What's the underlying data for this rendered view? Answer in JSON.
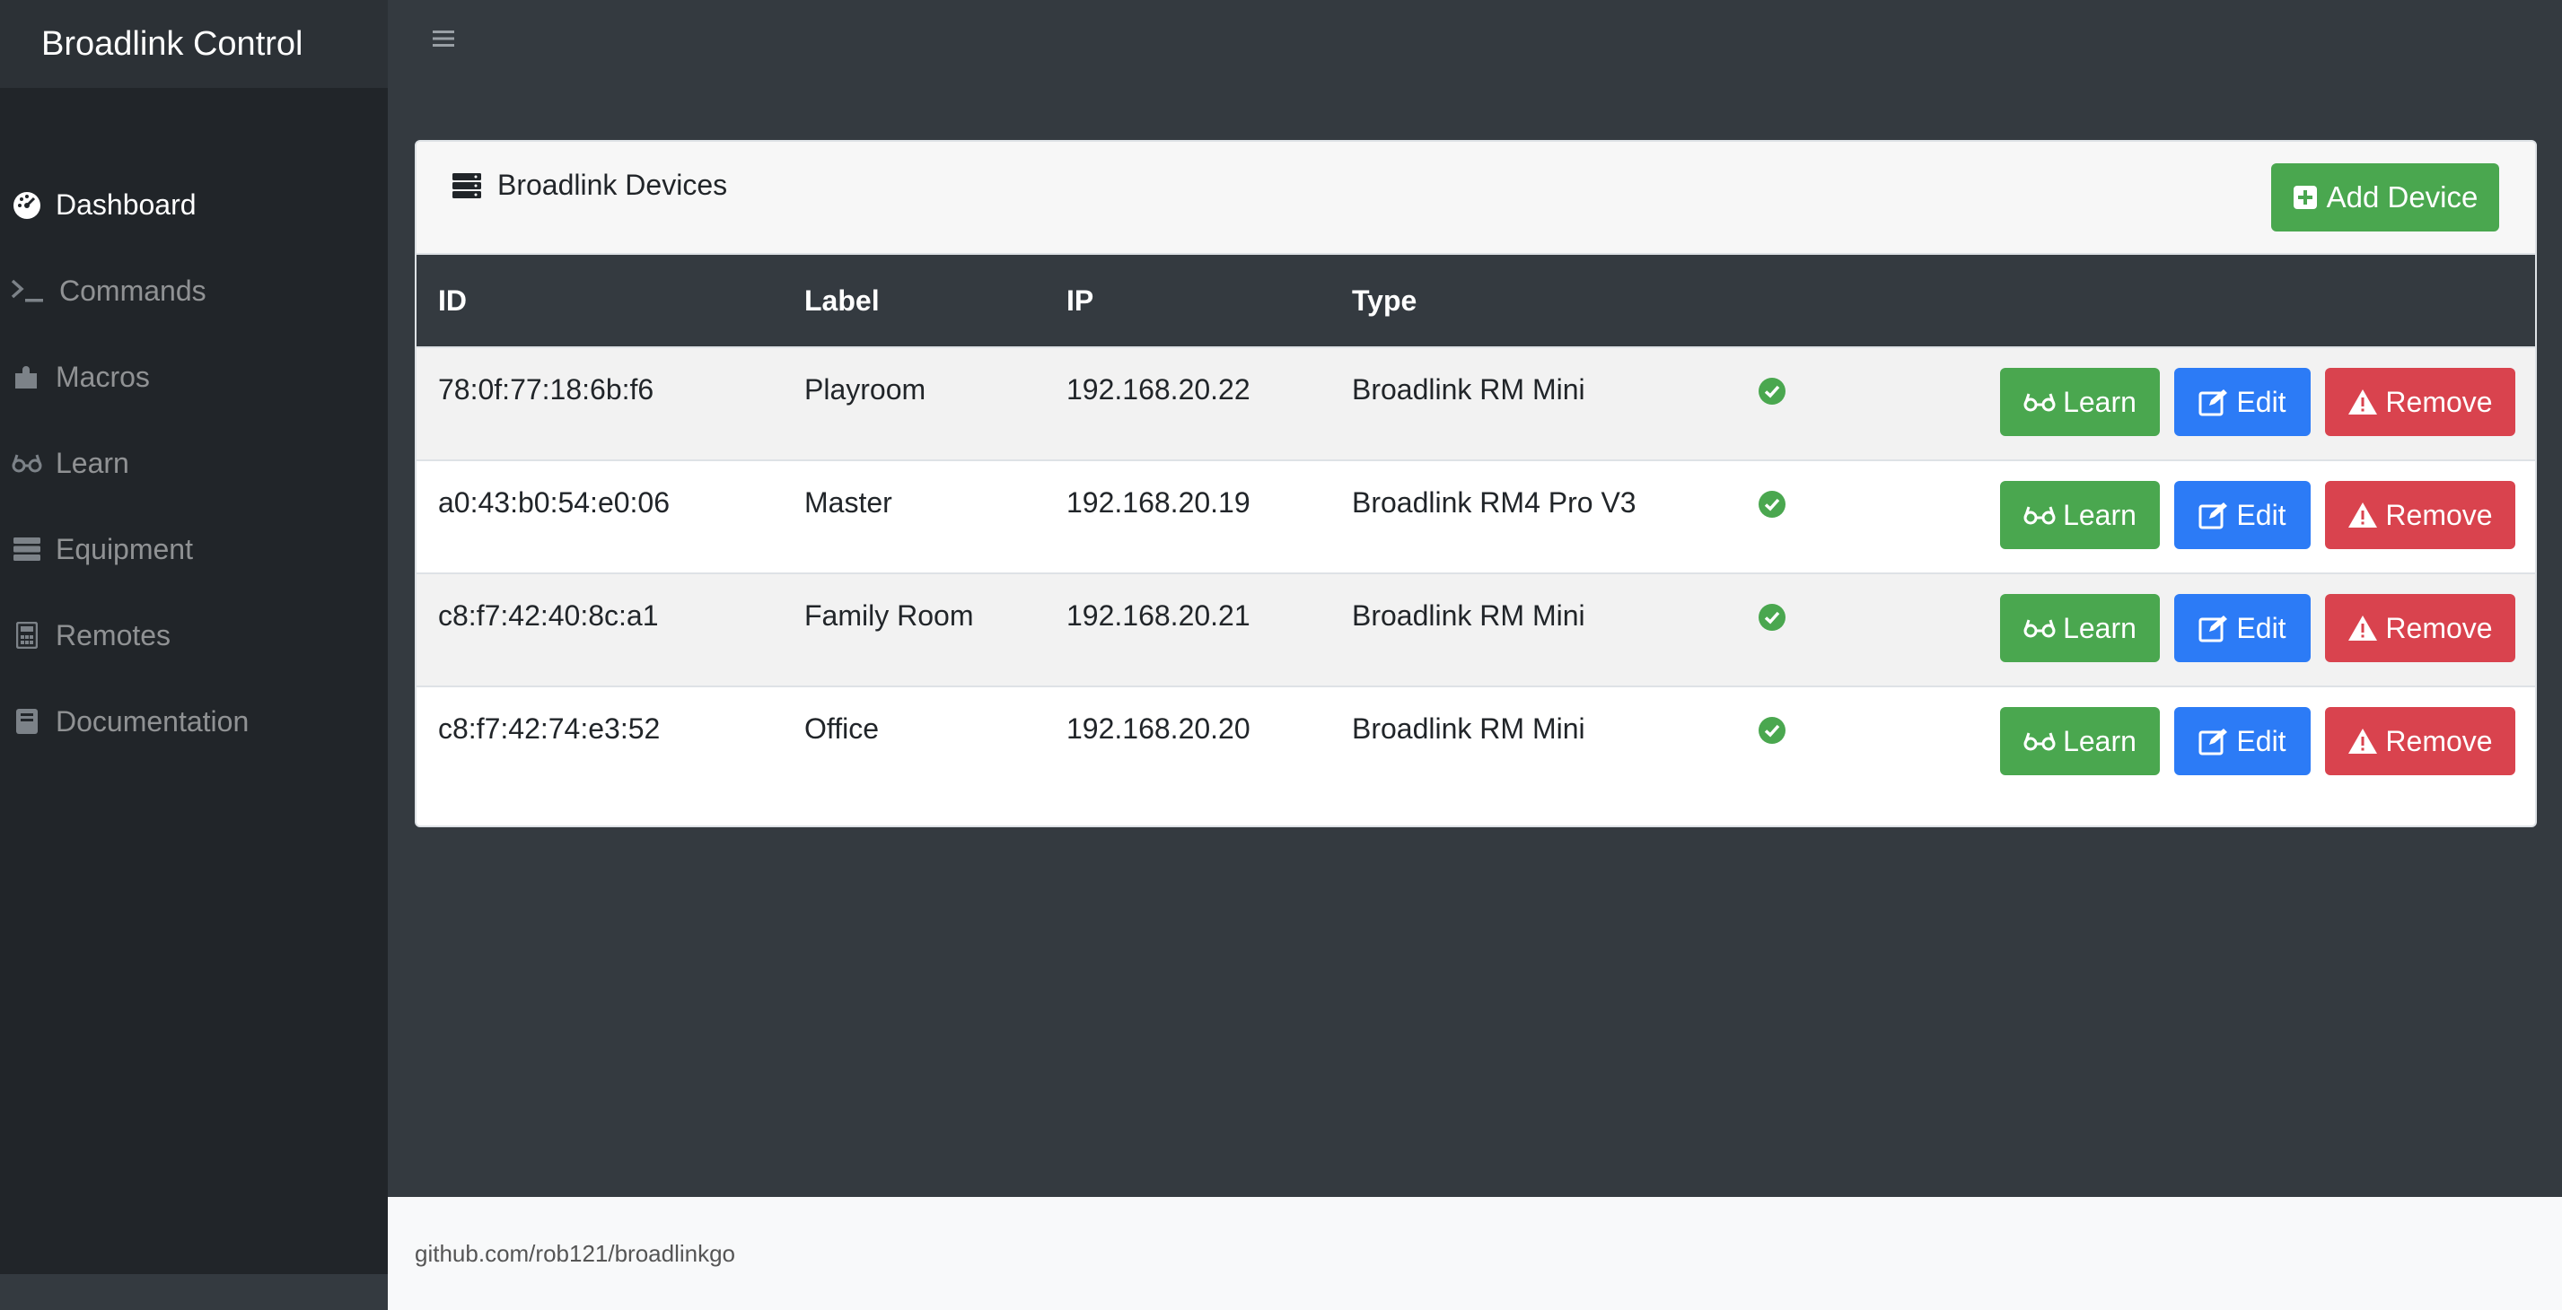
{
  "app": {
    "title": "Broadlink Control",
    "menu_icon": "hamburger-icon"
  },
  "sidebar": {
    "items": [
      {
        "label": "Dashboard",
        "icon": "speedometer-icon",
        "active": true
      },
      {
        "label": "Commands",
        "icon": "terminal-icon",
        "active": false
      },
      {
        "label": "Macros",
        "icon": "puzzle-icon",
        "active": false
      },
      {
        "label": "Learn",
        "icon": "glasses-icon",
        "active": false
      },
      {
        "label": "Equipment",
        "icon": "server-icon",
        "active": false
      },
      {
        "label": "Remotes",
        "icon": "calculator-icon",
        "active": false
      },
      {
        "label": "Documentation",
        "icon": "book-icon",
        "active": false
      }
    ]
  },
  "card": {
    "title": "Broadlink Devices",
    "title_icon": "server-icon",
    "add_button": "Add Device"
  },
  "table": {
    "headers": {
      "id": "ID",
      "label": "Label",
      "ip": "IP",
      "type": "Type"
    },
    "rows": [
      {
        "id": "78:0f:77:18:6b:f6",
        "label": "Playroom",
        "ip": "192.168.20.22",
        "type": "Broadlink RM Mini",
        "status": "online"
      },
      {
        "id": "a0:43:b0:54:e0:06",
        "label": "Master",
        "ip": "192.168.20.19",
        "type": "Broadlink RM4 Pro V3",
        "status": "online"
      },
      {
        "id": "c8:f7:42:40:8c:a1",
        "label": "Family Room",
        "ip": "192.168.20.21",
        "type": "Broadlink RM Mini",
        "status": "online"
      },
      {
        "id": "c8:f7:42:74:e3:52",
        "label": "Office",
        "ip": "192.168.20.20",
        "type": "Broadlink RM Mini",
        "status": "online"
      }
    ],
    "actions": {
      "learn": "Learn",
      "edit": "Edit",
      "remove": "Remove"
    }
  },
  "footer": {
    "text": "github.com/rob121/broadlinkgo"
  },
  "colors": {
    "success": "#4aa74f",
    "primary": "#2c7bf6",
    "danger": "#d9434e",
    "dark": "#343a40",
    "sidebar": "#212529"
  }
}
